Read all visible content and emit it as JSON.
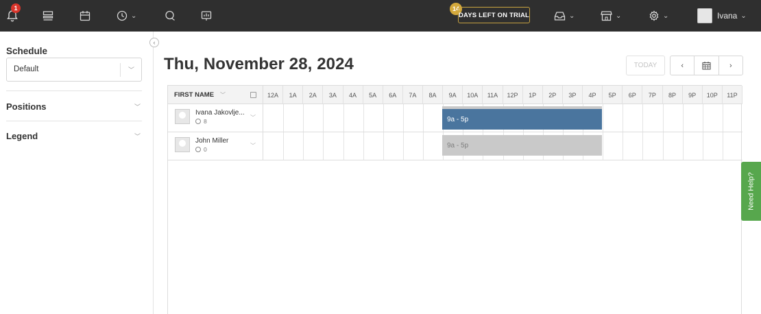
{
  "topbar": {
    "notification_count": "1",
    "trial_days": "14",
    "trial_label": "DAYS LEFT ON TRIAL",
    "user_name": "Ivana"
  },
  "sidebar": {
    "schedule_title": "Schedule",
    "schedule_value": "Default",
    "positions_label": "Positions",
    "legend_label": "Legend"
  },
  "main": {
    "date_title": "Thu, November 28, 2024",
    "today_button": "TODAY"
  },
  "grid": {
    "name_column_header": "FIRST NAME",
    "hours": [
      "12A",
      "1A",
      "2A",
      "3A",
      "4A",
      "5A",
      "6A",
      "7A",
      "8A",
      "9A",
      "10A",
      "11A",
      "12P",
      "1P",
      "2P",
      "3P",
      "4P",
      "5P",
      "6P",
      "7P",
      "8P",
      "9P",
      "10P",
      "11P"
    ],
    "employees": [
      {
        "name": "Ivana Jakovlje...",
        "hours": "8",
        "shift_label": "9a - 5p",
        "shift_style": "published",
        "shift_color": "#4a759e"
      },
      {
        "name": "John Miller",
        "hours": "0",
        "shift_label": "9a - 5p",
        "shift_style": "draft",
        "shift_color": "#c9c9c9"
      }
    ]
  },
  "help": {
    "label": "Need Help?",
    "color": "#57a74d"
  },
  "icons": [
    "bell-icon",
    "dashboard-icon",
    "calendar-icon",
    "clock-icon",
    "chat-icon",
    "reports-icon",
    "inbox-icon",
    "store-icon",
    "settings-icon"
  ]
}
